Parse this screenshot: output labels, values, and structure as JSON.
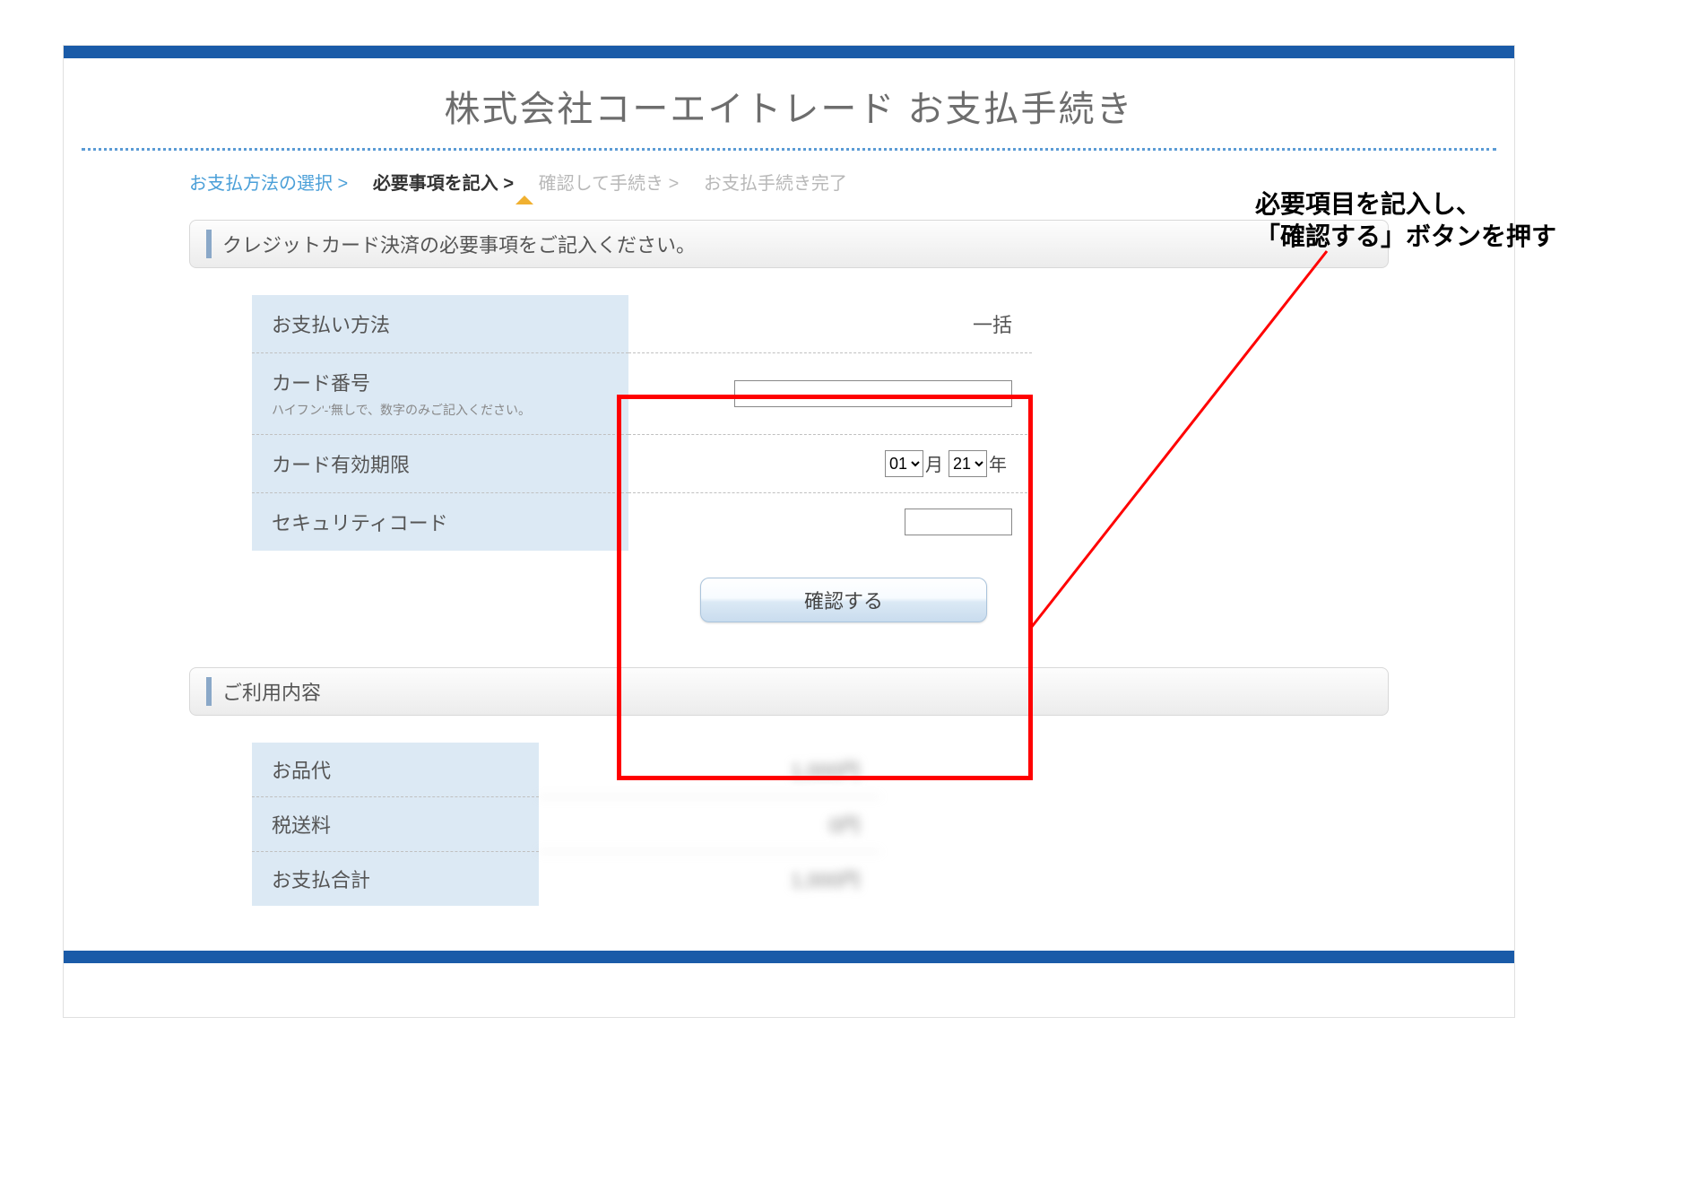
{
  "page_title": "株式会社コーエイトレード お支払手続き",
  "breadcrumb": {
    "step1": "お支払方法の選択 >",
    "step2": "必要事項を記入 >",
    "step3": "確認して手続き >",
    "step4": "お支払手続き完了"
  },
  "annotation": {
    "line1": "必要項目を記入し、",
    "line2": "「確認する」ボタンを押す"
  },
  "cc_section": {
    "header": "クレジットカード決済の必要事項をご記入ください。",
    "rows": {
      "payment_method_label": "お支払い方法",
      "payment_method_value": "一括",
      "card_number_label": "カード番号",
      "card_number_note": "ハイフン'-'無しで、数字のみご記入ください。",
      "expiry_label": "カード有効期限",
      "expiry_month": "01",
      "expiry_month_suffix": "月",
      "expiry_year": "21",
      "expiry_year_suffix": "年",
      "security_label": "セキュリティコード"
    },
    "confirm_button": "確認する"
  },
  "usage_section": {
    "header": "ご利用内容",
    "rows": {
      "item_label": "お品代",
      "item_value": "1,000円",
      "tax_label": "税送料",
      "tax_value": "0円",
      "total_label": "お支払合計",
      "total_value": "1,000円"
    }
  }
}
